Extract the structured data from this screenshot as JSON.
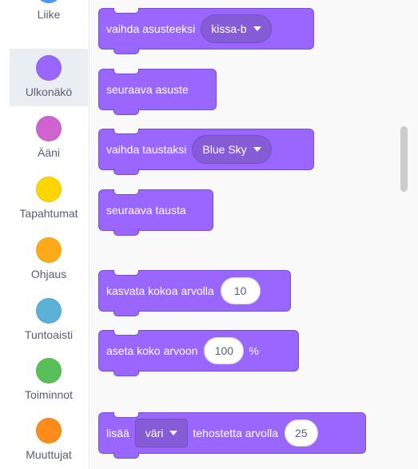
{
  "sidebar": {
    "categories": [
      {
        "label": "Liike",
        "color": "#4c97ff"
      },
      {
        "label": "Ulkonäkö",
        "color": "#9966ff",
        "selected": true
      },
      {
        "label": "Ääni",
        "color": "#cf63cf"
      },
      {
        "label": "Tapahtumat",
        "color": "#ffd500"
      },
      {
        "label": "Ohjaus",
        "color": "#ffab19"
      },
      {
        "label": "Tuntoaisti",
        "color": "#5cb1d6"
      },
      {
        "label": "Toiminnot",
        "color": "#59c059"
      },
      {
        "label": "Muuttujat",
        "color": "#ff8c1a"
      }
    ]
  },
  "blocks": {
    "switch_costume": {
      "text": "vaihda asusteeksi",
      "dropdown": "kissa-b"
    },
    "next_costume": {
      "text": "seuraava asuste"
    },
    "switch_backdrop": {
      "text": "vaihda taustaksi",
      "dropdown": "Blue Sky"
    },
    "next_backdrop": {
      "text": "seuraava tausta"
    },
    "change_size": {
      "text": "kasvata kokoa arvolla",
      "value": "10"
    },
    "set_size": {
      "text": "aseta koko arvoon",
      "value": "100",
      "suffix": "%"
    },
    "change_effect": {
      "text_before": "lisää",
      "dropdown": "väri",
      "text_after": "tehostetta arvolla",
      "value": "25"
    }
  },
  "colors": {
    "looks_block": "#9966ff",
    "looks_block_border": "#774dcb",
    "selected_category_bg": "#e9eef2"
  }
}
